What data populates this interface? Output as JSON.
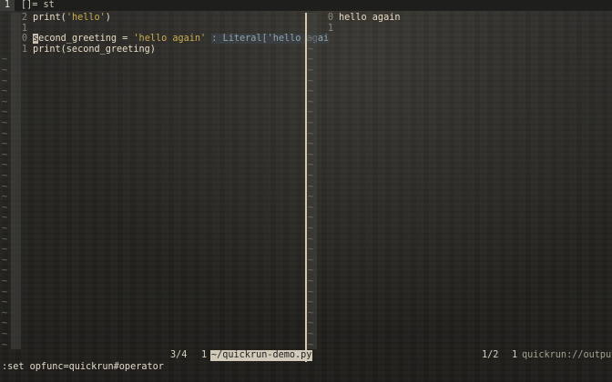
{
  "tabline": {
    "tab_number": "1",
    "text": "[]=  st"
  },
  "left_window": {
    "lines": [
      {
        "lnr": "2",
        "parts": [
          {
            "t": "print(",
            "c": "code"
          },
          {
            "t": "'hello'",
            "c": "str"
          },
          {
            "t": ")",
            "c": "code"
          }
        ]
      },
      {
        "lnr": "1",
        "parts": []
      },
      {
        "lnr": "0",
        "parts": [
          {
            "t": "s",
            "c": "cursor"
          },
          {
            "t": "econd_greeting = ",
            "c": "code"
          },
          {
            "t": "'hello again'",
            "c": "str"
          },
          {
            "t": " ",
            "c": "code"
          },
          {
            "t": ": Literal['hello agai",
            "c": "hint"
          }
        ]
      },
      {
        "lnr": "1",
        "parts": [
          {
            "t": "print(second_greeting)",
            "c": "code"
          }
        ]
      }
    ],
    "status_position": "3/4",
    "status_column": "1",
    "status_filename": "~/quickrun-demo.py"
  },
  "right_window": {
    "lines": [
      {
        "lnr": "0",
        "text": "hello again"
      },
      {
        "lnr": "1",
        "text": ""
      }
    ],
    "status_position": "1/2",
    "status_column": "1",
    "status_filename": "quickrun://output"
  },
  "tilde": "~",
  "command_line": ":set opfunc=quickrun#operator"
}
